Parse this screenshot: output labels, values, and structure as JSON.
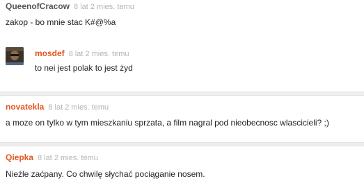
{
  "comments": [
    {
      "author": "QueenofCracow",
      "time": "8 lat 2 mies. temu",
      "text": "zakop - bo mnie stac K#@%a"
    },
    {
      "author": "mosdef",
      "time": "8 lat 2 mies. temu",
      "text": "to nei jest polak to jest żyd",
      "avatar": "user-avatar-photo"
    },
    {
      "author": "novatekla",
      "time": "8 lat 2 mies. temu",
      "text": "a moze on tylko w tym mieszkaniu sprzata, a film nagral pod nieobecnosc wlascicieli? ;)"
    },
    {
      "author": "Qiepka",
      "time": "8 lat 2 mies. temu",
      "text": "Nieźle zaćpany. Co chwilę słychać pociąganie nosem."
    }
  ],
  "colors": {
    "author_default": "#555555",
    "author_highlight": "#e5541f",
    "timestamp": "#b3b3b3",
    "separator": "#eeeeee"
  }
}
